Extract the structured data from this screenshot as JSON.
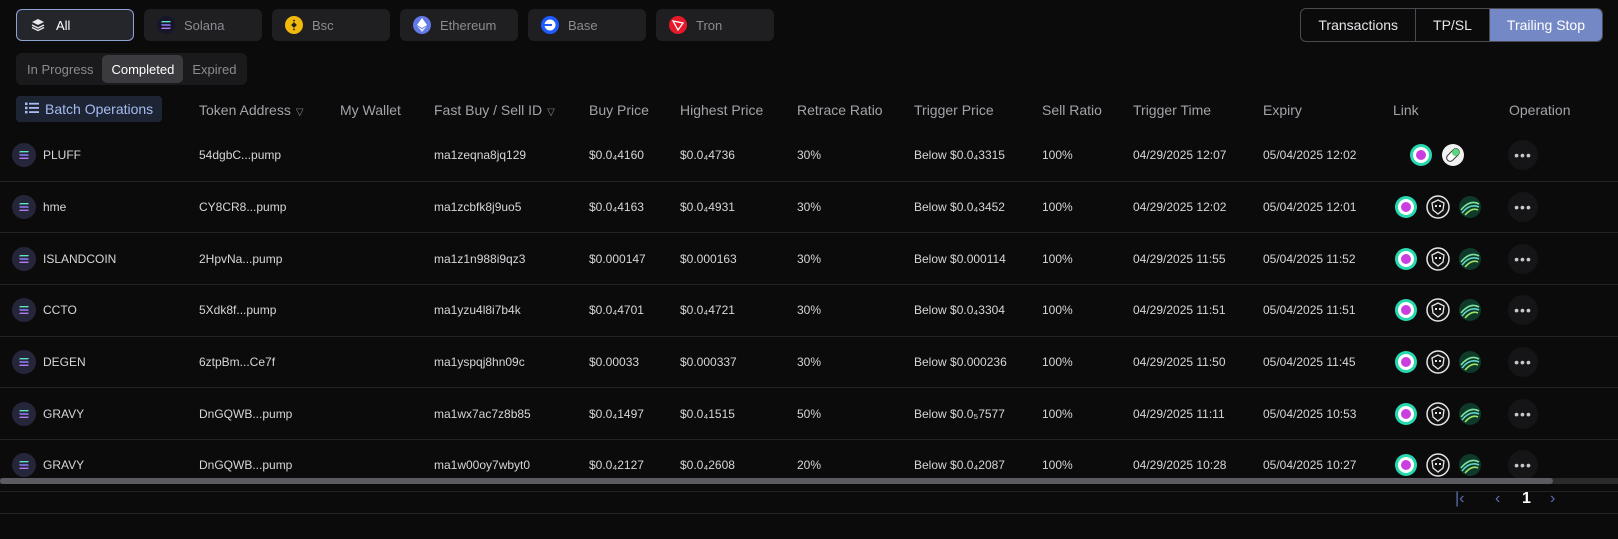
{
  "chains": [
    {
      "label": "All",
      "icon": "layers-icon",
      "active": true
    },
    {
      "label": "Solana",
      "icon": "solana-icon"
    },
    {
      "label": "Bsc",
      "icon": "bsc-icon"
    },
    {
      "label": "Ethereum",
      "icon": "ethereum-icon"
    },
    {
      "label": "Base",
      "icon": "base-icon"
    },
    {
      "label": "Tron",
      "icon": "tron-icon"
    }
  ],
  "view_tabs": [
    "Transactions",
    "TP/SL",
    "Trailing Stop"
  ],
  "view_selected": "Trailing Stop",
  "status_tabs": [
    "In Progress",
    "Completed",
    "Expired"
  ],
  "status_selected": "Completed",
  "batch_label": "Batch Operations",
  "columns": {
    "token_address": "Token Address",
    "my_wallet": "My Wallet",
    "fast_buy": "Fast Buy / Sell ID",
    "buy_price": "Buy Price",
    "highest_price": "Highest Price",
    "retrace_ratio": "Retrace Ratio",
    "trigger_price": "Trigger Price",
    "sell_ratio": "Sell Ratio",
    "trigger_time": "Trigger Time",
    "expiry": "Expiry",
    "link": "Link",
    "operation": "Operation"
  },
  "rows": [
    {
      "token": "PLUFF",
      "address": "54dgbC...pump",
      "wallet": "",
      "id": "ma1zeqna8jq129",
      "buy": "$0.0₄4160",
      "high": "$0.0₄4736",
      "retrace": "30%",
      "trigger": "Below $0.0₄3315",
      "sell": "100%",
      "trigger_time": "04/29/2025 12:07",
      "expiry": "05/04/2025 12:02"
    },
    {
      "token": "hme",
      "address": "CY8CR8...pump",
      "wallet": "",
      "id": "ma1zcbfk8j9uo5",
      "buy": "$0.0₄4163",
      "high": "$0.0₄4931",
      "retrace": "30%",
      "trigger": "Below $0.0₄3452",
      "sell": "100%",
      "trigger_time": "04/29/2025 12:02",
      "expiry": "05/04/2025 12:01"
    },
    {
      "token": "ISLANDCOIN",
      "address": "2HpvNa...pump",
      "wallet": "",
      "id": "ma1z1n988i9qz3",
      "buy": "$0.000147",
      "high": "$0.000163",
      "retrace": "30%",
      "trigger": "Below $0.000114",
      "sell": "100%",
      "trigger_time": "04/29/2025 11:55",
      "expiry": "05/04/2025 11:52"
    },
    {
      "token": "CCTO",
      "address": "5Xdk8f...pump",
      "wallet": "",
      "id": "ma1yzu4l8i7b4k",
      "buy": "$0.0₄4701",
      "high": "$0.0₄4721",
      "retrace": "30%",
      "trigger": "Below $0.0₄3304",
      "sell": "100%",
      "trigger_time": "04/29/2025 11:51",
      "expiry": "05/04/2025 11:51"
    },
    {
      "token": "DEGEN",
      "address": "6ztpBm...Ce7f",
      "wallet": "",
      "id": "ma1yspqj8hn09c",
      "buy": "$0.00033",
      "high": "$0.000337",
      "retrace": "30%",
      "trigger": "Below $0.000236",
      "sell": "100%",
      "trigger_time": "04/29/2025 11:50",
      "expiry": "05/04/2025 11:45"
    },
    {
      "token": "GRAVY",
      "address": "DnGQWB...pump",
      "wallet": "",
      "id": "ma1wx7ac7z8b85",
      "buy": "$0.0₄1497",
      "high": "$0.0₄1515",
      "retrace": "50%",
      "trigger": "Below $0.0₅7577",
      "sell": "100%",
      "trigger_time": "04/29/2025 11:11",
      "expiry": "05/04/2025 10:53"
    },
    {
      "token": "GRAVY",
      "address": "DnGQWB...pump",
      "wallet": "",
      "id": "ma1w00oy7wbyt0",
      "buy": "$0.0₄2127",
      "high": "$0.0₄2608",
      "retrace": "20%",
      "trigger": "Below $0.0₄2087",
      "sell": "100%",
      "trigger_time": "04/29/2025 10:28",
      "expiry": "05/04/2025 10:27"
    }
  ],
  "pagination": {
    "current_page": "1"
  },
  "colors": {
    "accent": "#7488c5",
    "link_accent": "#a8bbf0"
  }
}
